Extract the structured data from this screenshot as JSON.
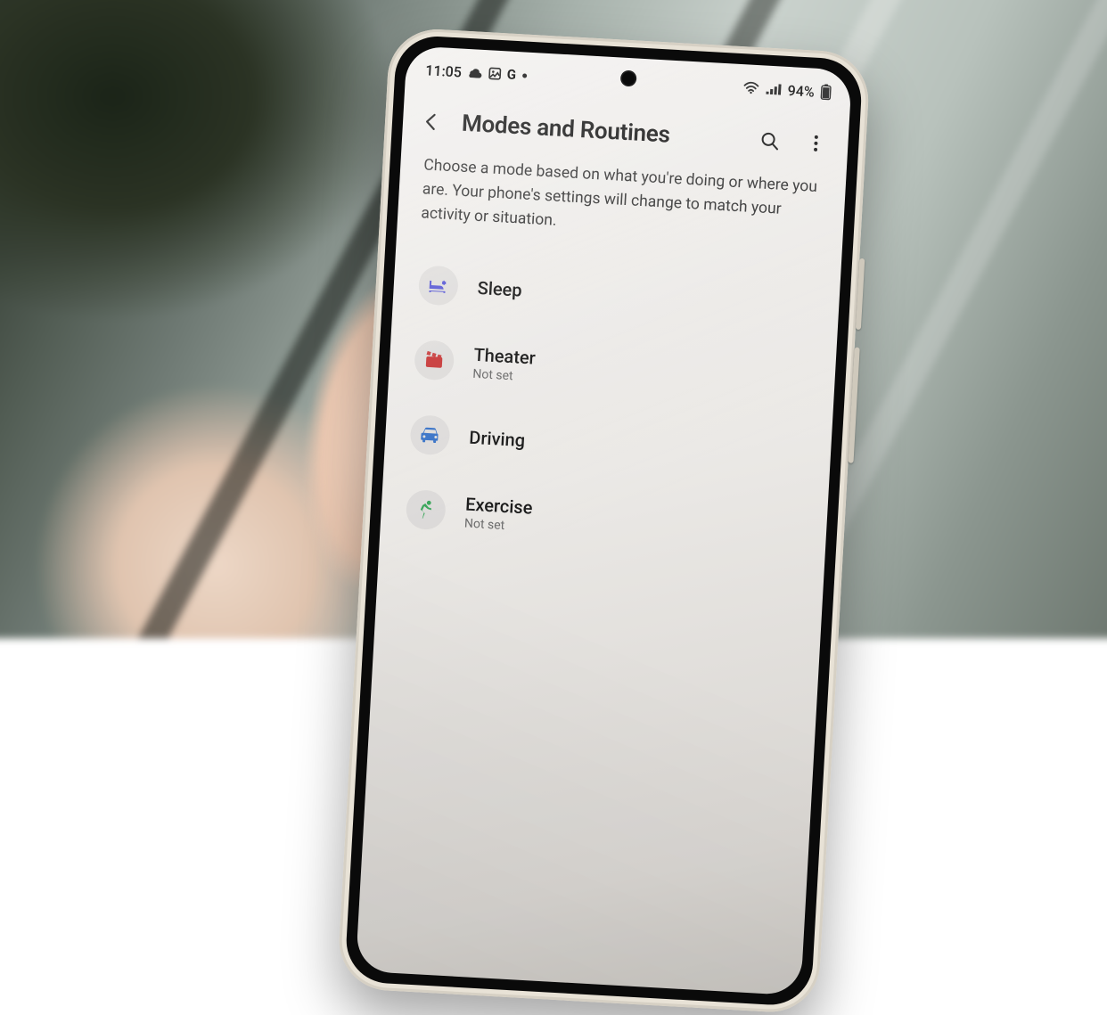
{
  "status": {
    "time": "11:05",
    "battery_pct": "94%",
    "left_icons": [
      "cloud-icon",
      "image-icon",
      "g-icon",
      "dot-icon"
    ],
    "right_icons": [
      "wifi-icon",
      "signal-icon",
      "battery-icon"
    ]
  },
  "header": {
    "title": "Modes and Routines"
  },
  "description": "Choose a mode based on what you're doing or where you are. Your phone's settings will change to match your activity or situation.",
  "modes": [
    {
      "icon": "bed-icon",
      "color": "#5b5bd6",
      "label": "Sleep",
      "sub": ""
    },
    {
      "icon": "theater-icon",
      "color": "#c83a3a",
      "label": "Theater",
      "sub": "Not set"
    },
    {
      "icon": "car-icon",
      "color": "#3a74c8",
      "label": "Driving",
      "sub": ""
    },
    {
      "icon": "exercise-icon",
      "color": "#3aa65a",
      "label": "Exercise",
      "sub": "Not set"
    }
  ]
}
